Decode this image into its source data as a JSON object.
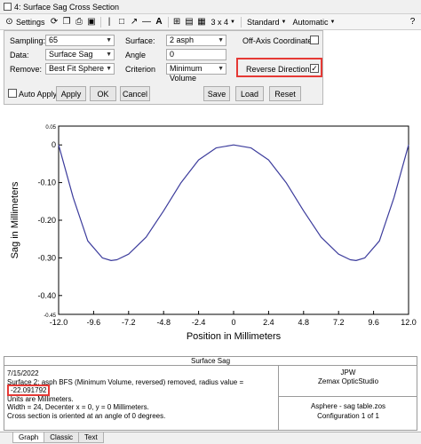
{
  "window": {
    "title": "4: Surface Sag Cross Section"
  },
  "toolbar": {
    "settings_label": "Settings",
    "grid_label": "3 x 4",
    "standard_label": "Standard",
    "automatic_label": "Automatic"
  },
  "settings": {
    "sampling": {
      "label": "Sampling:",
      "value": "65"
    },
    "data": {
      "label": "Data:",
      "value": "Surface Sag"
    },
    "remove": {
      "label": "Remove:",
      "value": "Best Fit Sphere"
    },
    "surface": {
      "label": "Surface:",
      "value": "2 asph"
    },
    "angle": {
      "label": "Angle",
      "value": "0"
    },
    "criterion": {
      "label": "Criterion",
      "value": "Minimum Volume"
    },
    "off_axis": {
      "label": "Off-Axis Coordinates",
      "checked": false
    },
    "reverse": {
      "label": "Reverse Direction",
      "checked": true,
      "mark": "✓"
    },
    "auto_apply": {
      "label": "Auto Apply",
      "checked": false
    },
    "buttons": {
      "apply": "Apply",
      "ok": "OK",
      "cancel": "Cancel",
      "save": "Save",
      "load": "Load",
      "reset": "Reset"
    }
  },
  "chart_data": {
    "type": "line",
    "xlabel": "Position in Millimeters",
    "ylabel": "Sag in Millimeters",
    "xlim": [
      -12.0,
      12.0
    ],
    "ylim": [
      -0.45,
      0.05
    ],
    "x_ticks": [
      "-12.0",
      "-9.6",
      "-7.2",
      "-4.8",
      "-2.4",
      "0",
      "2.4",
      "4.8",
      "7.2",
      "9.6",
      "12.0"
    ],
    "y_ticks": [
      {
        "value": 0.05,
        "label": "0.05"
      },
      {
        "value": 0,
        "label": "0"
      },
      {
        "value": -0.1,
        "label": "-0.10"
      },
      {
        "value": -0.2,
        "label": "-0.20"
      },
      {
        "value": -0.3,
        "label": "-0.30"
      },
      {
        "value": -0.4,
        "label": "-0.40"
      },
      {
        "value": -0.45,
        "label": "-0.45"
      }
    ],
    "grid": false,
    "series": [
      {
        "color": "#3c3c9c",
        "x": [
          -12.0,
          -11.0,
          -10.0,
          -9.0,
          -8.4,
          -8.0,
          -7.2,
          -6.0,
          -4.8,
          -3.6,
          -2.4,
          -1.2,
          0,
          1.2,
          2.4,
          3.6,
          4.8,
          6.0,
          7.2,
          8.0,
          8.4,
          9.0,
          10.0,
          11.0,
          12.0
        ],
        "y": [
          0.0,
          -0.14,
          -0.255,
          -0.3,
          -0.307,
          -0.305,
          -0.29,
          -0.245,
          -0.175,
          -0.1,
          -0.04,
          -0.008,
          0.0,
          -0.008,
          -0.04,
          -0.1,
          -0.175,
          -0.245,
          -0.29,
          -0.305,
          -0.307,
          -0.3,
          -0.255,
          -0.14,
          0.0
        ]
      }
    ]
  },
  "info": {
    "title": "Surface Sag",
    "date": "7/15/2022",
    "line1": "Surface 2: asph BFS (Minimum Volume, reversed) removed, radius value = ",
    "radius": "-22.091792",
    "line2": "Units are Millimeters.",
    "line3": "Width = 24, Decenter x = 0, y = 0 Millimeters.",
    "line4": "Cross section is oriented at an angle of 0 degrees.",
    "author": "JPW",
    "software": "Zemax OpticStudio",
    "file": "Asphere - sag table.zos",
    "config": "Configuration 1 of 1"
  },
  "tabs": {
    "graph": "Graph",
    "classic": "Classic",
    "text": "Text"
  }
}
